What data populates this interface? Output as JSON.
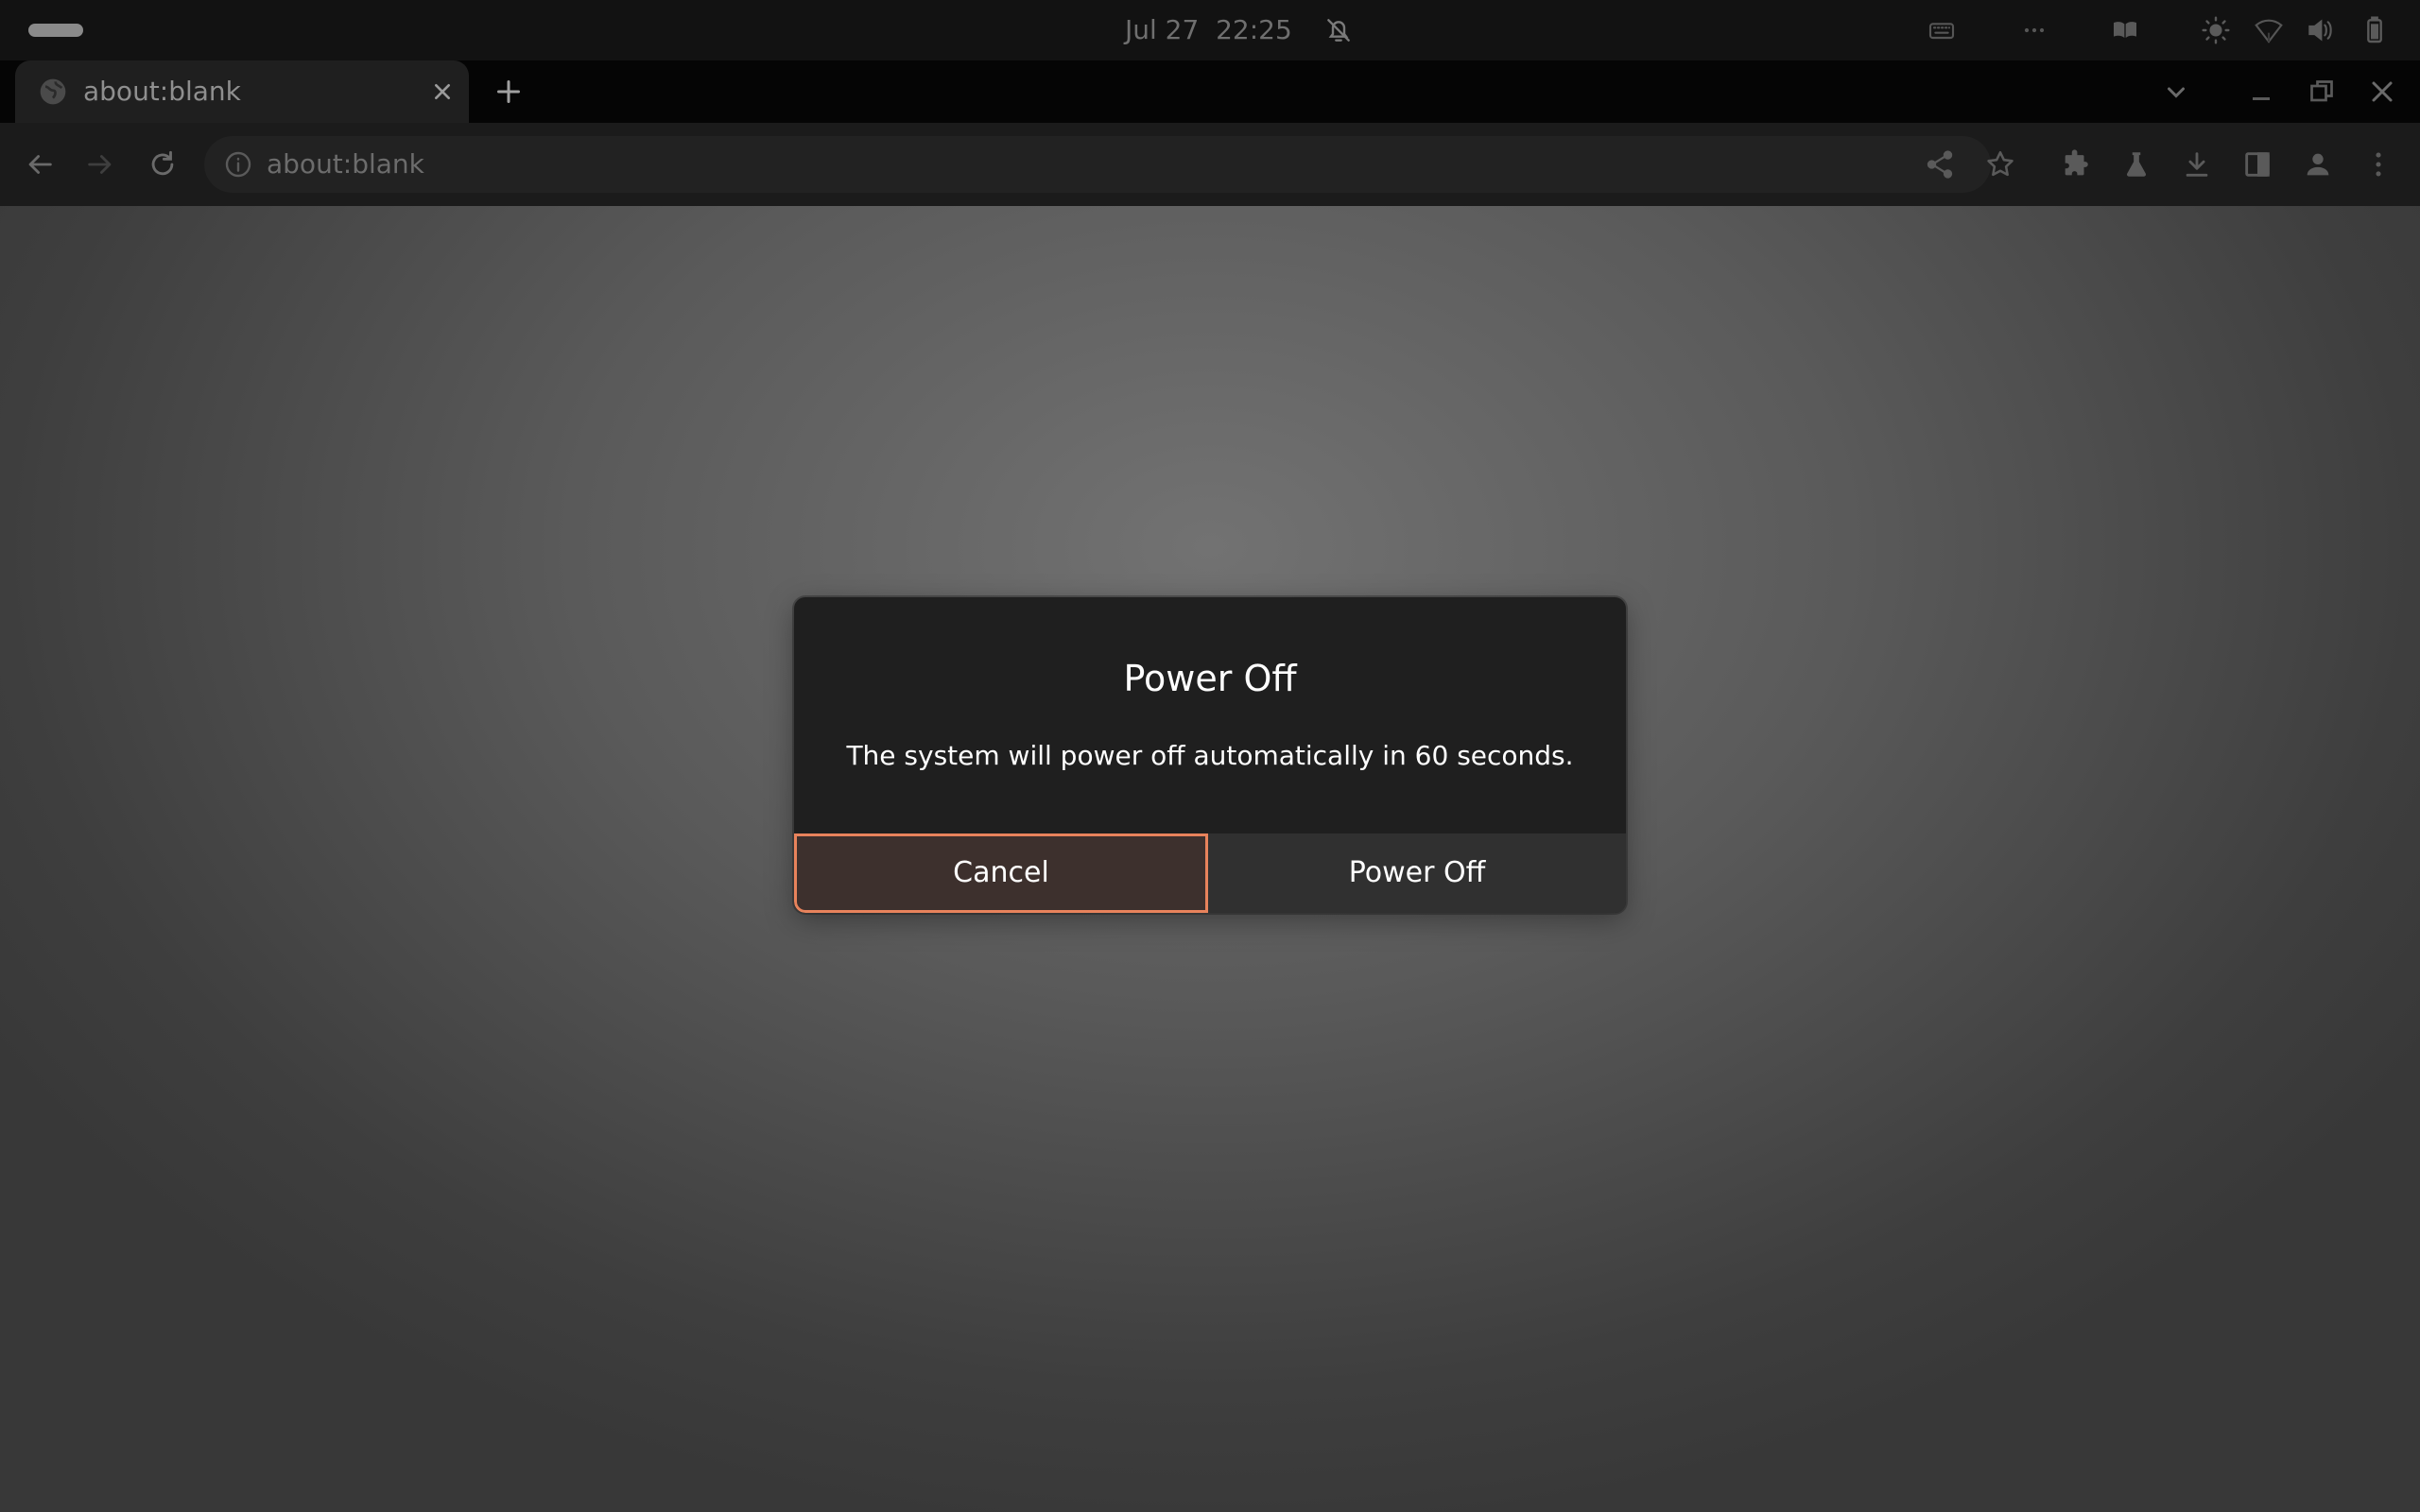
{
  "topbar": {
    "clock_text": "Jul 27  22:25",
    "icons": [
      "activities-pill",
      "notifications-muted-icon",
      "keyboard-icon",
      "more-icon",
      "book-icon",
      "brightness-icon",
      "wifi-icon",
      "volume-icon",
      "battery-icon"
    ]
  },
  "browser": {
    "tab": {
      "title": "about:blank",
      "favicon": "globe-icon"
    },
    "url": "about:blank",
    "toolbar_icons": [
      "back-icon",
      "forward-icon",
      "reload-icon",
      "info-icon",
      "share-icon",
      "star-icon",
      "extensions-icon",
      "labs-icon",
      "download-icon",
      "side-panel-icon",
      "profile-icon",
      "menu-icon"
    ],
    "window_controls": [
      "tab-search-icon",
      "minimize-icon",
      "maximize-icon",
      "close-icon"
    ]
  },
  "dialog": {
    "title": "Power Off",
    "message": "The system will power off automatically in 60 seconds.",
    "cancel_label": "Cancel",
    "confirm_label": "Power Off",
    "focus_color": "#e8835c"
  },
  "colors": {
    "topbar": "#121212",
    "tabstrip": "#050505",
    "toolbar": "#1b1b1b",
    "dialog_bg": "#1f1f1f"
  }
}
